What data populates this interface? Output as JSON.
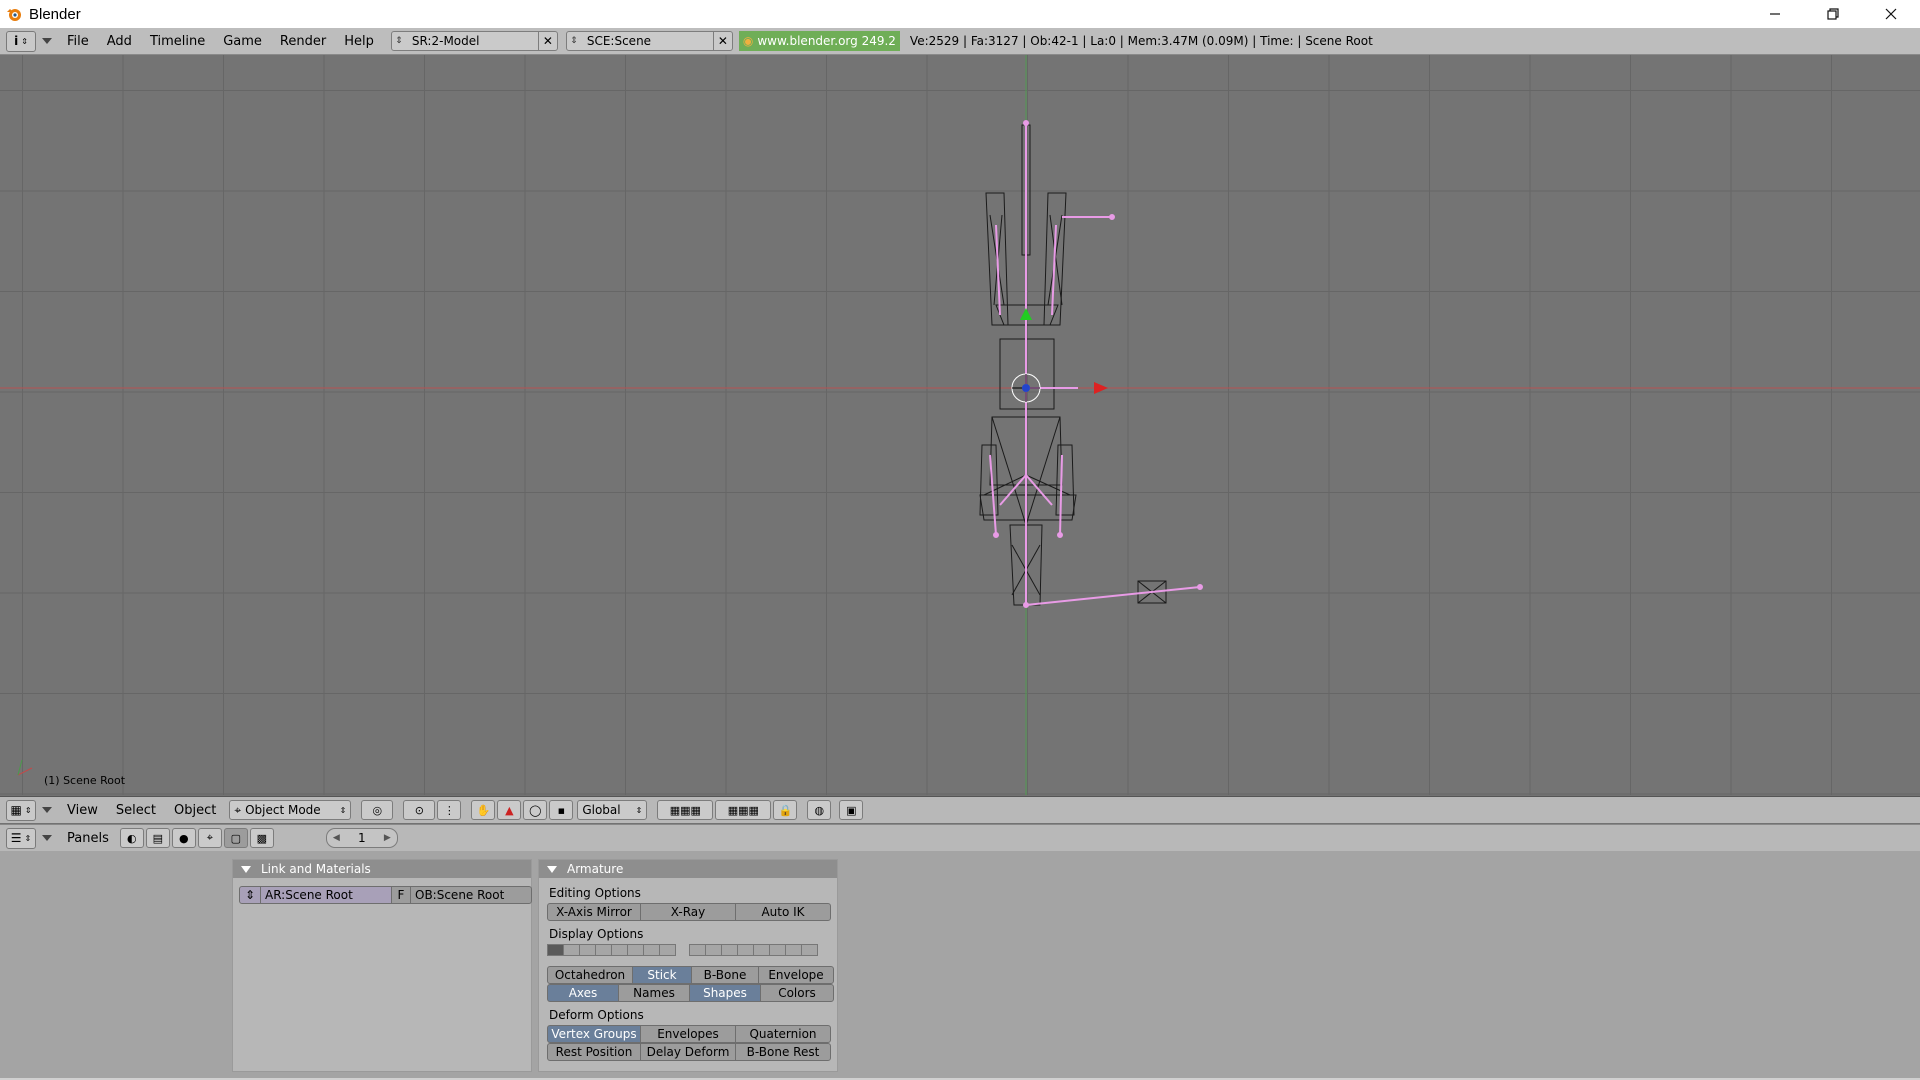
{
  "window": {
    "title": "Blender",
    "minimize_label": "minimize",
    "maximize_label": "maximize",
    "close_label": "close"
  },
  "info_header": {
    "menus": [
      "File",
      "Add",
      "Timeline",
      "Game",
      "Render",
      "Help"
    ],
    "screen_name": "SR:2-Model",
    "scene_name": "SCE:Scene",
    "version": "www.blender.org 249.2",
    "stats": "Ve:2529 | Fa:3127 | Ob:42-1 | La:0  | Mem:3.47M (0.09M)  | Time: | Scene Root"
  },
  "viewport": {
    "object_label": "(1) Scene Root",
    "grid_color": "#666666",
    "x_axis_color": "#c24a4a",
    "y_axis_color": "#4a9a4a",
    "bone_color": "#e89be6"
  },
  "view_header": {
    "menus": [
      "View",
      "Select",
      "Object"
    ],
    "mode": "Object Mode",
    "orientation": "Global"
  },
  "panels_header": {
    "label": "Panels",
    "frame": "1"
  },
  "link_panel": {
    "title": "Link and Materials",
    "armature": "AR:Scene Root",
    "fake_user": "F",
    "object": "OB:Scene Root"
  },
  "armature_panel": {
    "title": "Armature",
    "editing_label": "Editing Options",
    "editing_buttons": [
      "X-Axis Mirror",
      "X-Ray",
      "Auto IK"
    ],
    "display_label": "Display Options",
    "display_row1": [
      "Octahedron",
      "Stick",
      "B-Bone",
      "Envelope"
    ],
    "display_row2": [
      "Axes",
      "Names",
      "Shapes",
      "Colors"
    ],
    "deform_label": "Deform Options",
    "deform_row1": [
      "Vertex Groups",
      "Envelopes",
      "Quaternion"
    ],
    "deform_row2": [
      "Rest Position",
      "Delay Deform",
      "B-Bone Rest"
    ]
  }
}
